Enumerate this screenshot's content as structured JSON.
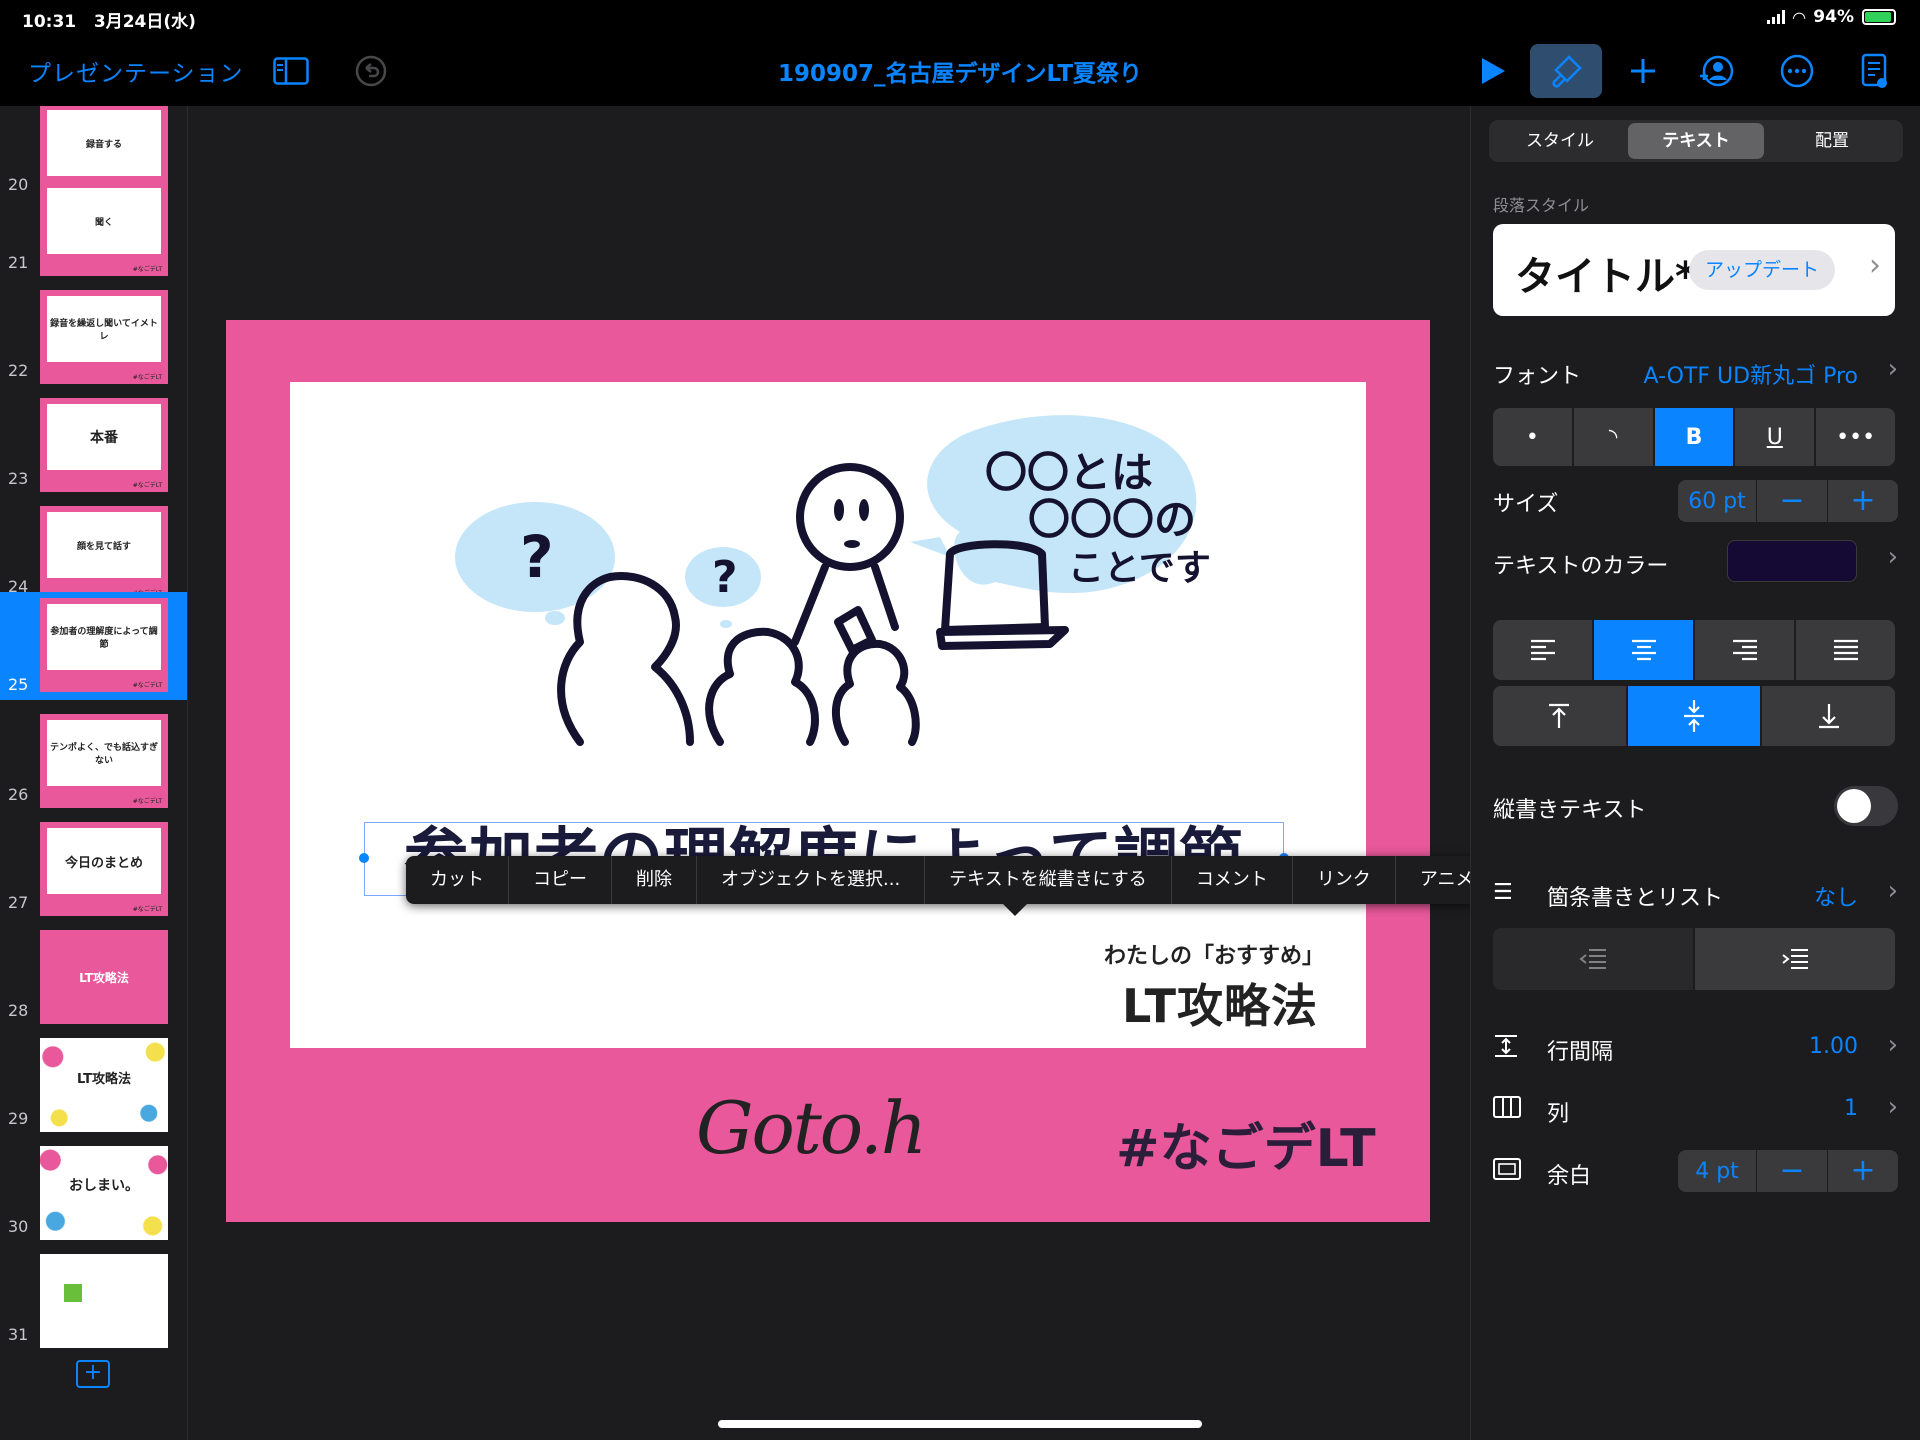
{
  "status": {
    "time": "10:31",
    "date": "3月24日(水)",
    "battery": "94%"
  },
  "toolbar": {
    "back_label": "プレゼンテーション",
    "doc_title": "190907_名古屋デザインLT夏祭り"
  },
  "navigator": {
    "slides": [
      {
        "num": "20",
        "text": "録音する"
      },
      {
        "num": "21",
        "text": "聞く"
      },
      {
        "num": "22",
        "text": "録音を繰返し聞いてイメトレ"
      },
      {
        "num": "23",
        "text": "本番"
      },
      {
        "num": "24",
        "text": "顔を見て話す"
      },
      {
        "num": "25",
        "text": "参加者の理解度によって調節"
      },
      {
        "num": "26",
        "text": "テンポよく、でも話込すぎない"
      },
      {
        "num": "27",
        "text": "今日のまとめ"
      },
      {
        "num": "28",
        "text": "LT攻略法"
      },
      {
        "num": "29",
        "text": "LT攻略法"
      },
      {
        "num": "30",
        "text": "おしまい。"
      },
      {
        "num": "31",
        "text": ""
      }
    ],
    "thumb_footer": "#なごデLT"
  },
  "slide": {
    "bubble_text_1": "〇〇とは",
    "bubble_text_2": "〇〇〇の",
    "bubble_text_3": "ことです",
    "question": "?",
    "title": "参加者の理解度によって調節",
    "tagline_small": "わたしの「おすすめ」",
    "tagline_big": "LT攻略法",
    "logo": "Goto.h",
    "hashtag": "#なごデLT"
  },
  "context_menu": [
    "カット",
    "コピー",
    "削除",
    "オブジェクトを選択...",
    "テキストを縦書きにする",
    "コメント",
    "リンク",
    "アニメーション"
  ],
  "inspector": {
    "tabs": [
      "スタイル",
      "テキスト",
      "配置"
    ],
    "active_tab": "テキスト",
    "para_style_label": "段落スタイル",
    "para_style_name": "タイトル*",
    "update_label": "アップデート",
    "font_label": "フォント",
    "font_value": "A-OTF UD新丸ゴ Pro",
    "style_buttons": [
      "•",
      "◝",
      "B",
      "U",
      "•••"
    ],
    "size_label": "サイズ",
    "size_value": "60 pt",
    "text_color_label": "テキストのカラー",
    "text_color": "#150a33",
    "vertical_text_label": "縦書きテキスト",
    "bullets_label": "箇条書きとリスト",
    "bullets_value": "なし",
    "line_spacing_label": "行間隔",
    "line_spacing_value": "1.00",
    "columns_label": "列",
    "columns_value": "1",
    "margin_label": "余白",
    "margin_value": "4 pt",
    "minus": "−",
    "plus": "+"
  },
  "colors": {
    "accent": "#0a84ff",
    "slide_pink": "#e8589a",
    "background": "#1c1c1e"
  }
}
